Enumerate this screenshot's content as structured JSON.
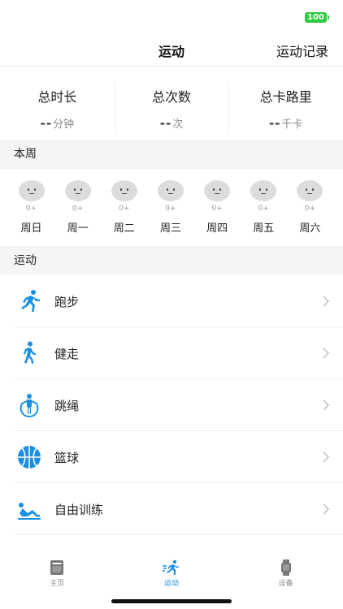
{
  "status_bar": {
    "battery": "100"
  },
  "nav": {
    "title": "运动",
    "right_action": "运动记录"
  },
  "stats": [
    {
      "label": "总时长",
      "value": "--",
      "unit": "分钟"
    },
    {
      "label": "总次数",
      "value": "--",
      "unit": "次"
    },
    {
      "label": "总卡路里",
      "value": "--",
      "unit": "千卡"
    }
  ],
  "week_section": {
    "title": "本周",
    "days": [
      {
        "label": "周日",
        "value": "0+"
      },
      {
        "label": "周一",
        "value": "0+"
      },
      {
        "label": "周二",
        "value": "0+"
      },
      {
        "label": "周三",
        "value": "0+"
      },
      {
        "label": "周四",
        "value": "0+"
      },
      {
        "label": "周五",
        "value": "0+"
      },
      {
        "label": "周六",
        "value": "0+"
      }
    ]
  },
  "sport_section": {
    "title": "运动",
    "items": [
      {
        "label": "跑步",
        "icon": "running-icon"
      },
      {
        "label": "健走",
        "icon": "walking-icon"
      },
      {
        "label": "跳绳",
        "icon": "jump-rope-icon"
      },
      {
        "label": "篮球",
        "icon": "basketball-icon"
      },
      {
        "label": "自由训练",
        "icon": "situp-icon"
      }
    ]
  },
  "tabs": [
    {
      "label": "主页",
      "icon": "home-icon",
      "active": false
    },
    {
      "label": "运动",
      "icon": "sport-icon",
      "active": true
    },
    {
      "label": "设备",
      "icon": "watch-icon",
      "active": false
    }
  ],
  "colors": {
    "accent": "#1a8fe3",
    "battery": "#2ecc40",
    "section_bg": "#f5f5f7"
  }
}
